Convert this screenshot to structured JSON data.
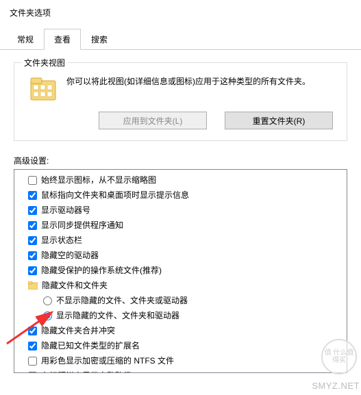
{
  "dialog": {
    "title": "文件夹选项"
  },
  "tabs": {
    "general": "常规",
    "view": "查看",
    "search": "搜索"
  },
  "folderViews": {
    "groupLabel": "文件夹视图",
    "description": "你可以将此视图(如详细信息或图标)应用于这种类型的所有文件夹。",
    "applyBtn": "应用到文件夹(L)",
    "resetBtn": "重置文件夹(R)"
  },
  "advanced": {
    "label": "高级设置:",
    "items": [
      {
        "type": "checkbox",
        "checked": false,
        "label": "始终显示图标，从不显示缩略图"
      },
      {
        "type": "checkbox",
        "checked": true,
        "label": "鼠标指向文件夹和桌面项时显示提示信息"
      },
      {
        "type": "checkbox",
        "checked": true,
        "label": "显示驱动器号"
      },
      {
        "type": "checkbox",
        "checked": true,
        "label": "显示同步提供程序通知"
      },
      {
        "type": "checkbox",
        "checked": true,
        "label": "显示状态栏"
      },
      {
        "type": "checkbox",
        "checked": true,
        "label": "隐藏空的驱动器"
      },
      {
        "type": "checkbox",
        "checked": true,
        "label": "隐藏受保护的操作系统文件(推荐)"
      },
      {
        "type": "folder",
        "label": "隐藏文件和文件夹"
      },
      {
        "type": "radio",
        "name": "hidden",
        "checked": false,
        "sub": true,
        "label": "不显示隐藏的文件、文件夹或驱动器"
      },
      {
        "type": "radio",
        "name": "hidden",
        "checked": true,
        "sub": true,
        "label": "显示隐藏的文件、文件夹和驱动器"
      },
      {
        "type": "checkbox",
        "checked": true,
        "label": "隐藏文件夹合并冲突"
      },
      {
        "type": "checkbox",
        "checked": true,
        "label": "隐藏已知文件类型的扩展名"
      },
      {
        "type": "checkbox",
        "checked": false,
        "label": "用彩色显示加密或压缩的 NTFS 文件"
      },
      {
        "type": "checkbox",
        "checked": false,
        "label": "在标题栏中显示完整路径"
      }
    ]
  },
  "watermark": {
    "circle": "值 什么值得买",
    "text": "SMYZ.NET"
  }
}
